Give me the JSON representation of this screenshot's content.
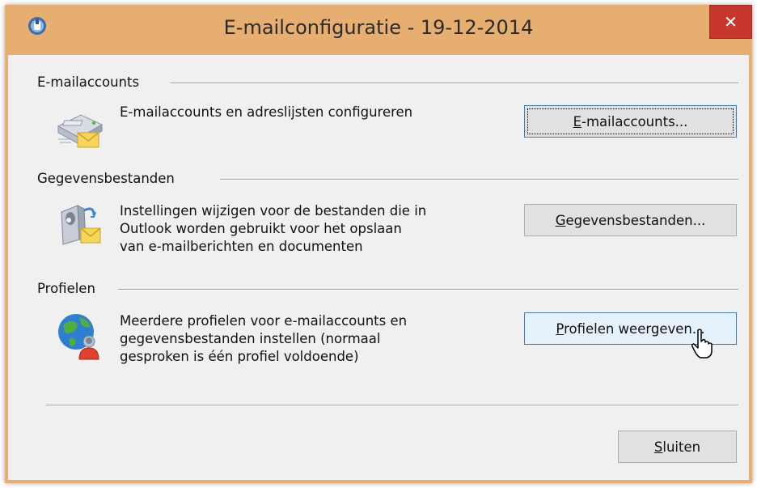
{
  "window": {
    "title": "E-mailconfiguratie - 19-12-2014",
    "close_symbol": "✕"
  },
  "sections": [
    {
      "heading": "E-mailaccounts",
      "description": [
        "E-mailaccounts en adreslijsten configureren"
      ],
      "button": {
        "accel": "E",
        "rest": "-mailaccounts..."
      },
      "icon": "email-accounts-icon"
    },
    {
      "heading": "Gegevensbestanden",
      "description": [
        "Instellingen wijzigen voor de bestanden die in",
        "Outlook worden gebruikt voor het opslaan",
        "van e-mailberichten en documenten"
      ],
      "button": {
        "accel": "G",
        "rest": "egevensbestanden..."
      },
      "icon": "data-files-icon"
    },
    {
      "heading": "Profielen",
      "description": [
        "Meerdere profielen voor e-mailaccounts en",
        "gegevensbestanden instellen (normaal",
        "gesproken is één profiel voldoende)"
      ],
      "button": {
        "accel": "P",
        "rest": "rofielen weergeven..."
      },
      "icon": "profiles-globe-icon"
    }
  ],
  "footer": {
    "close_button": {
      "accel": "S",
      "rest": "luiten"
    }
  },
  "colors": {
    "titlebar": "#e6ae70",
    "close": "#c7372d",
    "client": "#f0f0f0"
  }
}
